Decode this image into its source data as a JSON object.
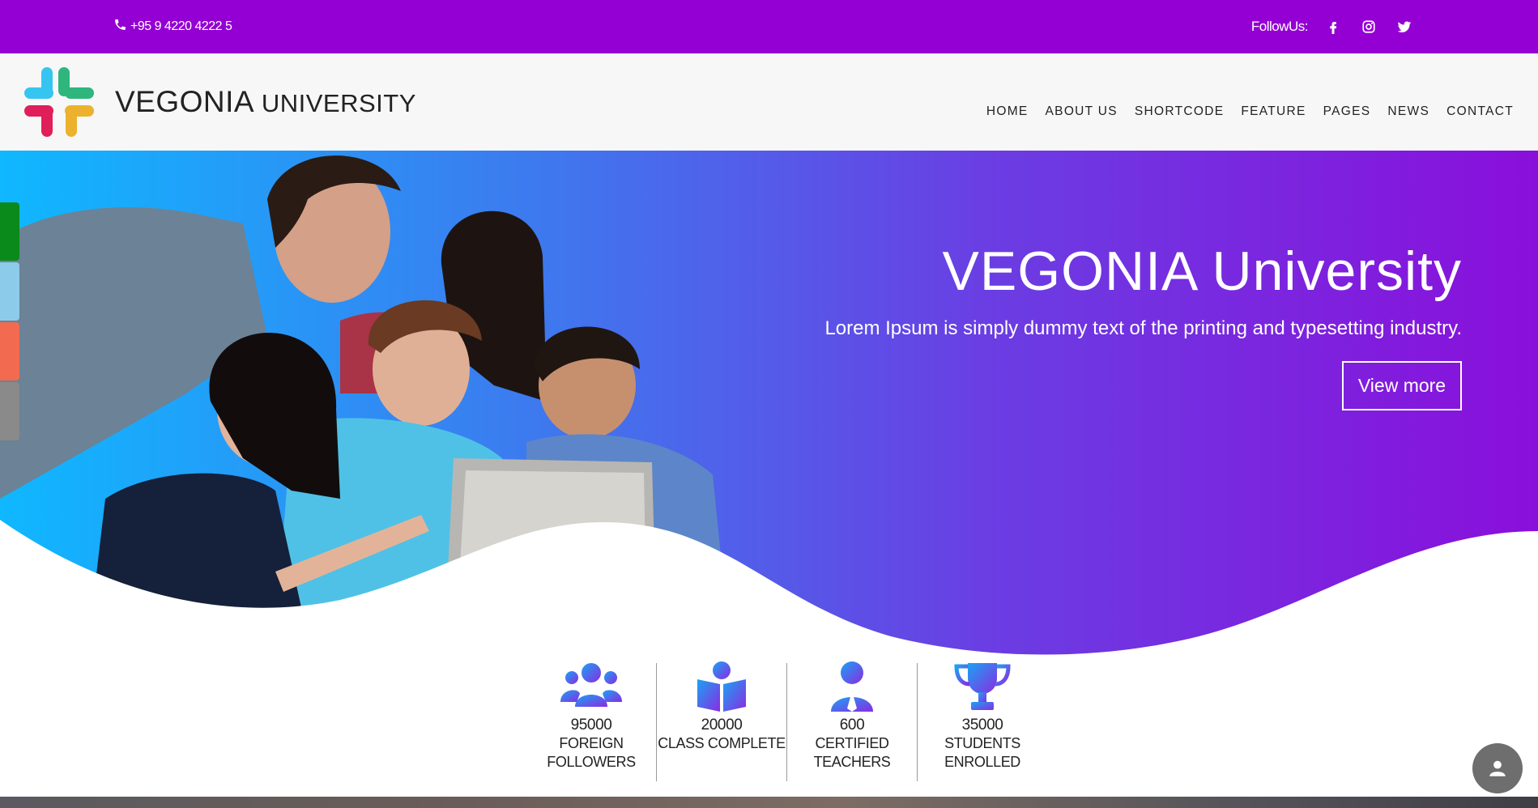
{
  "topbar": {
    "phone": "+95 9 4220 4222 5",
    "follow_label": "FollowUs:",
    "socials": [
      "facebook-icon",
      "instagram-icon",
      "twitter-icon"
    ],
    "bg_color": "#9400d3"
  },
  "brand": {
    "name_main": "VEGONIA",
    "name_secondary": "UNIVERSITY"
  },
  "nav": {
    "items": [
      "HOME",
      "ABOUT US",
      "SHORTCODE",
      "FEATURE",
      "PAGES",
      "NEWS",
      "CONTACT"
    ]
  },
  "hero": {
    "title": "VEGONIA University",
    "subtitle": "Lorem Ipsum is simply dummy text of the printing and typesetting industry.",
    "button": "View more",
    "gradient_colors": [
      "#0fb8ff",
      "#8a0fdb"
    ]
  },
  "side_switcher": {
    "colors": [
      "#0a8a1a",
      "#8ccbea",
      "#f26a4f",
      "#8a8a8a"
    ]
  },
  "stats": [
    {
      "icon": "group-icon",
      "value": "95000",
      "label_line1": "FOREIGN",
      "label_line2": "FOLLOWERS"
    },
    {
      "icon": "book-reader-icon",
      "value": "20000",
      "label_line1": "CLASS COMPLETE",
      "label_line2": ""
    },
    {
      "icon": "teacher-icon",
      "value": "600",
      "label_line1": "CERTIFIED",
      "label_line2": "TEACHERS"
    },
    {
      "icon": "trophy-icon",
      "value": "35000",
      "label_line1": "STUDENTS",
      "label_line2": "ENROLLED"
    }
  ],
  "fab": {
    "icon": "user-icon"
  }
}
